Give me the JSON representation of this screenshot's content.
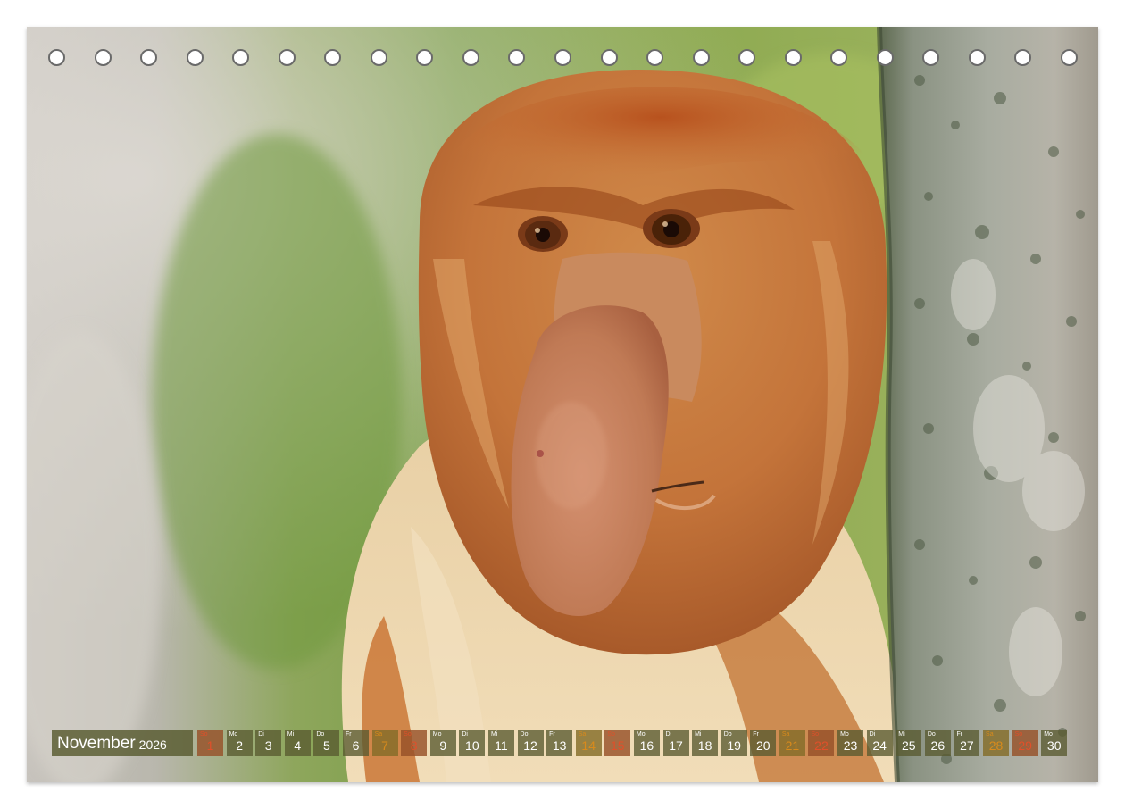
{
  "calendar": {
    "month": "November",
    "year": "2026",
    "days": [
      {
        "wd": "So",
        "num": "1",
        "kind": "sunday"
      },
      {
        "wd": "Mo",
        "num": "2",
        "kind": "weekday"
      },
      {
        "wd": "Di",
        "num": "3",
        "kind": "weekday"
      },
      {
        "wd": "Mi",
        "num": "4",
        "kind": "weekday"
      },
      {
        "wd": "Do",
        "num": "5",
        "kind": "weekday"
      },
      {
        "wd": "Fr",
        "num": "6",
        "kind": "weekday"
      },
      {
        "wd": "Sa",
        "num": "7",
        "kind": "weekend"
      },
      {
        "wd": "So",
        "num": "8",
        "kind": "sunday"
      },
      {
        "wd": "Mo",
        "num": "9",
        "kind": "weekday"
      },
      {
        "wd": "Di",
        "num": "10",
        "kind": "weekday"
      },
      {
        "wd": "Mi",
        "num": "11",
        "kind": "weekday"
      },
      {
        "wd": "Do",
        "num": "12",
        "kind": "weekday"
      },
      {
        "wd": "Fr",
        "num": "13",
        "kind": "weekday"
      },
      {
        "wd": "Sa",
        "num": "14",
        "kind": "weekend"
      },
      {
        "wd": "So",
        "num": "15",
        "kind": "sunday"
      },
      {
        "wd": "Mo",
        "num": "16",
        "kind": "weekday"
      },
      {
        "wd": "Di",
        "num": "17",
        "kind": "weekday"
      },
      {
        "wd": "Mi",
        "num": "18",
        "kind": "weekday"
      },
      {
        "wd": "Do",
        "num": "19",
        "kind": "weekday"
      },
      {
        "wd": "Fr",
        "num": "20",
        "kind": "weekday"
      },
      {
        "wd": "Sa",
        "num": "21",
        "kind": "weekend"
      },
      {
        "wd": "So",
        "num": "22",
        "kind": "sunday"
      },
      {
        "wd": "Mo",
        "num": "23",
        "kind": "weekday"
      },
      {
        "wd": "Di",
        "num": "24",
        "kind": "weekday"
      },
      {
        "wd": "Mi",
        "num": "25",
        "kind": "weekday"
      },
      {
        "wd": "Do",
        "num": "26",
        "kind": "weekday"
      },
      {
        "wd": "Fr",
        "num": "27",
        "kind": "weekday"
      },
      {
        "wd": "Sa",
        "num": "28",
        "kind": "weekend"
      },
      {
        "wd": "So",
        "num": "29",
        "kind": "sunday"
      },
      {
        "wd": "Mo",
        "num": "30",
        "kind": "weekday"
      }
    ]
  },
  "binding": {
    "hole_count": 23
  },
  "colors": {
    "fur": "#c8763a",
    "nose": "#c27a55",
    "bark": "#9aa094",
    "background_green": "#7fa24a",
    "bar": "#585a30"
  }
}
